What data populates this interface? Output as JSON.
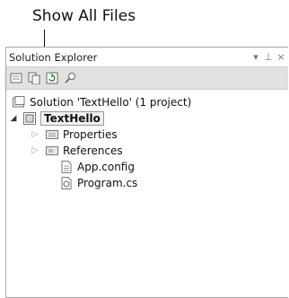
{
  "callout": {
    "text": "Show All Files"
  },
  "panel": {
    "title": "Solution Explorer",
    "dropdown_glyph": "▾",
    "pin_glyph": "⊥",
    "close_glyph": "×"
  },
  "toolbar": {
    "buttons": [
      {
        "icon": "properties-icon"
      },
      {
        "icon": "show-all-files-icon"
      },
      {
        "icon": "refresh-icon"
      },
      {
        "icon": "view-class-diagram-icon"
      }
    ]
  },
  "tree": {
    "solution_label": "Solution 'TextHello' (1 project)",
    "project_label": "TextHello",
    "items": [
      {
        "label": "Properties",
        "expand": "▷",
        "icon": "properties-folder-icon"
      },
      {
        "label": "References",
        "expand": "▷",
        "icon": "references-folder-icon"
      },
      {
        "label": "App.config",
        "icon": "config-file-icon"
      },
      {
        "label": "Program.cs",
        "icon": "csharp-file-icon"
      }
    ],
    "project_expand": "◢"
  },
  "colors": {
    "toolbar_bg": "#e1e1e1",
    "border": "#a7a7a7",
    "selection_border": "#9a9a9a"
  }
}
